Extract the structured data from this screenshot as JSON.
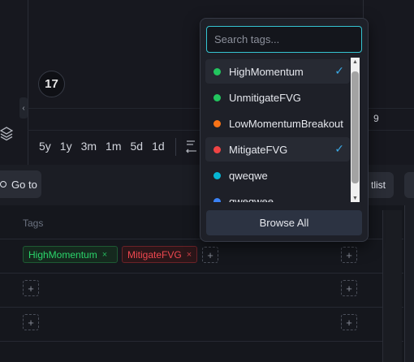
{
  "chart": {
    "time_ranges": [
      "5y",
      "1y",
      "3m",
      "1m",
      "5d",
      "1d"
    ],
    "axis_label": "9",
    "logo_text": "17"
  },
  "toolbar": {
    "goto_label": "Go to",
    "watchlist_label": "tlist"
  },
  "table": {
    "tags_header": "Tags",
    "rows": [
      {
        "tags": [
          {
            "label": "HighMomentum",
            "color": "#2bd66b"
          },
          {
            "label": "MitigateFVG",
            "color": "#f0484f"
          }
        ]
      },
      {
        "tags": []
      },
      {
        "tags": []
      }
    ],
    "add_symbol": "+",
    "remove_symbol": "×"
  },
  "tag_dropdown": {
    "search_placeholder": "Search tags...",
    "search_value": "",
    "items": [
      {
        "label": "HighMomentum",
        "color": "#22c55e",
        "selected": true
      },
      {
        "label": "UnmitigateFVG",
        "color": "#22c55e",
        "selected": false
      },
      {
        "label": "LowMomentumBreakout",
        "color": "#f97316",
        "selected": false
      },
      {
        "label": "MitigateFVG",
        "color": "#ef4444",
        "selected": true
      },
      {
        "label": "qweqwe",
        "color": "#06b6d4",
        "selected": false
      },
      {
        "label": "qweqwee",
        "color": "#3b82f6",
        "selected": false
      }
    ],
    "check_mark": "✓",
    "browse_label": "Browse All"
  }
}
